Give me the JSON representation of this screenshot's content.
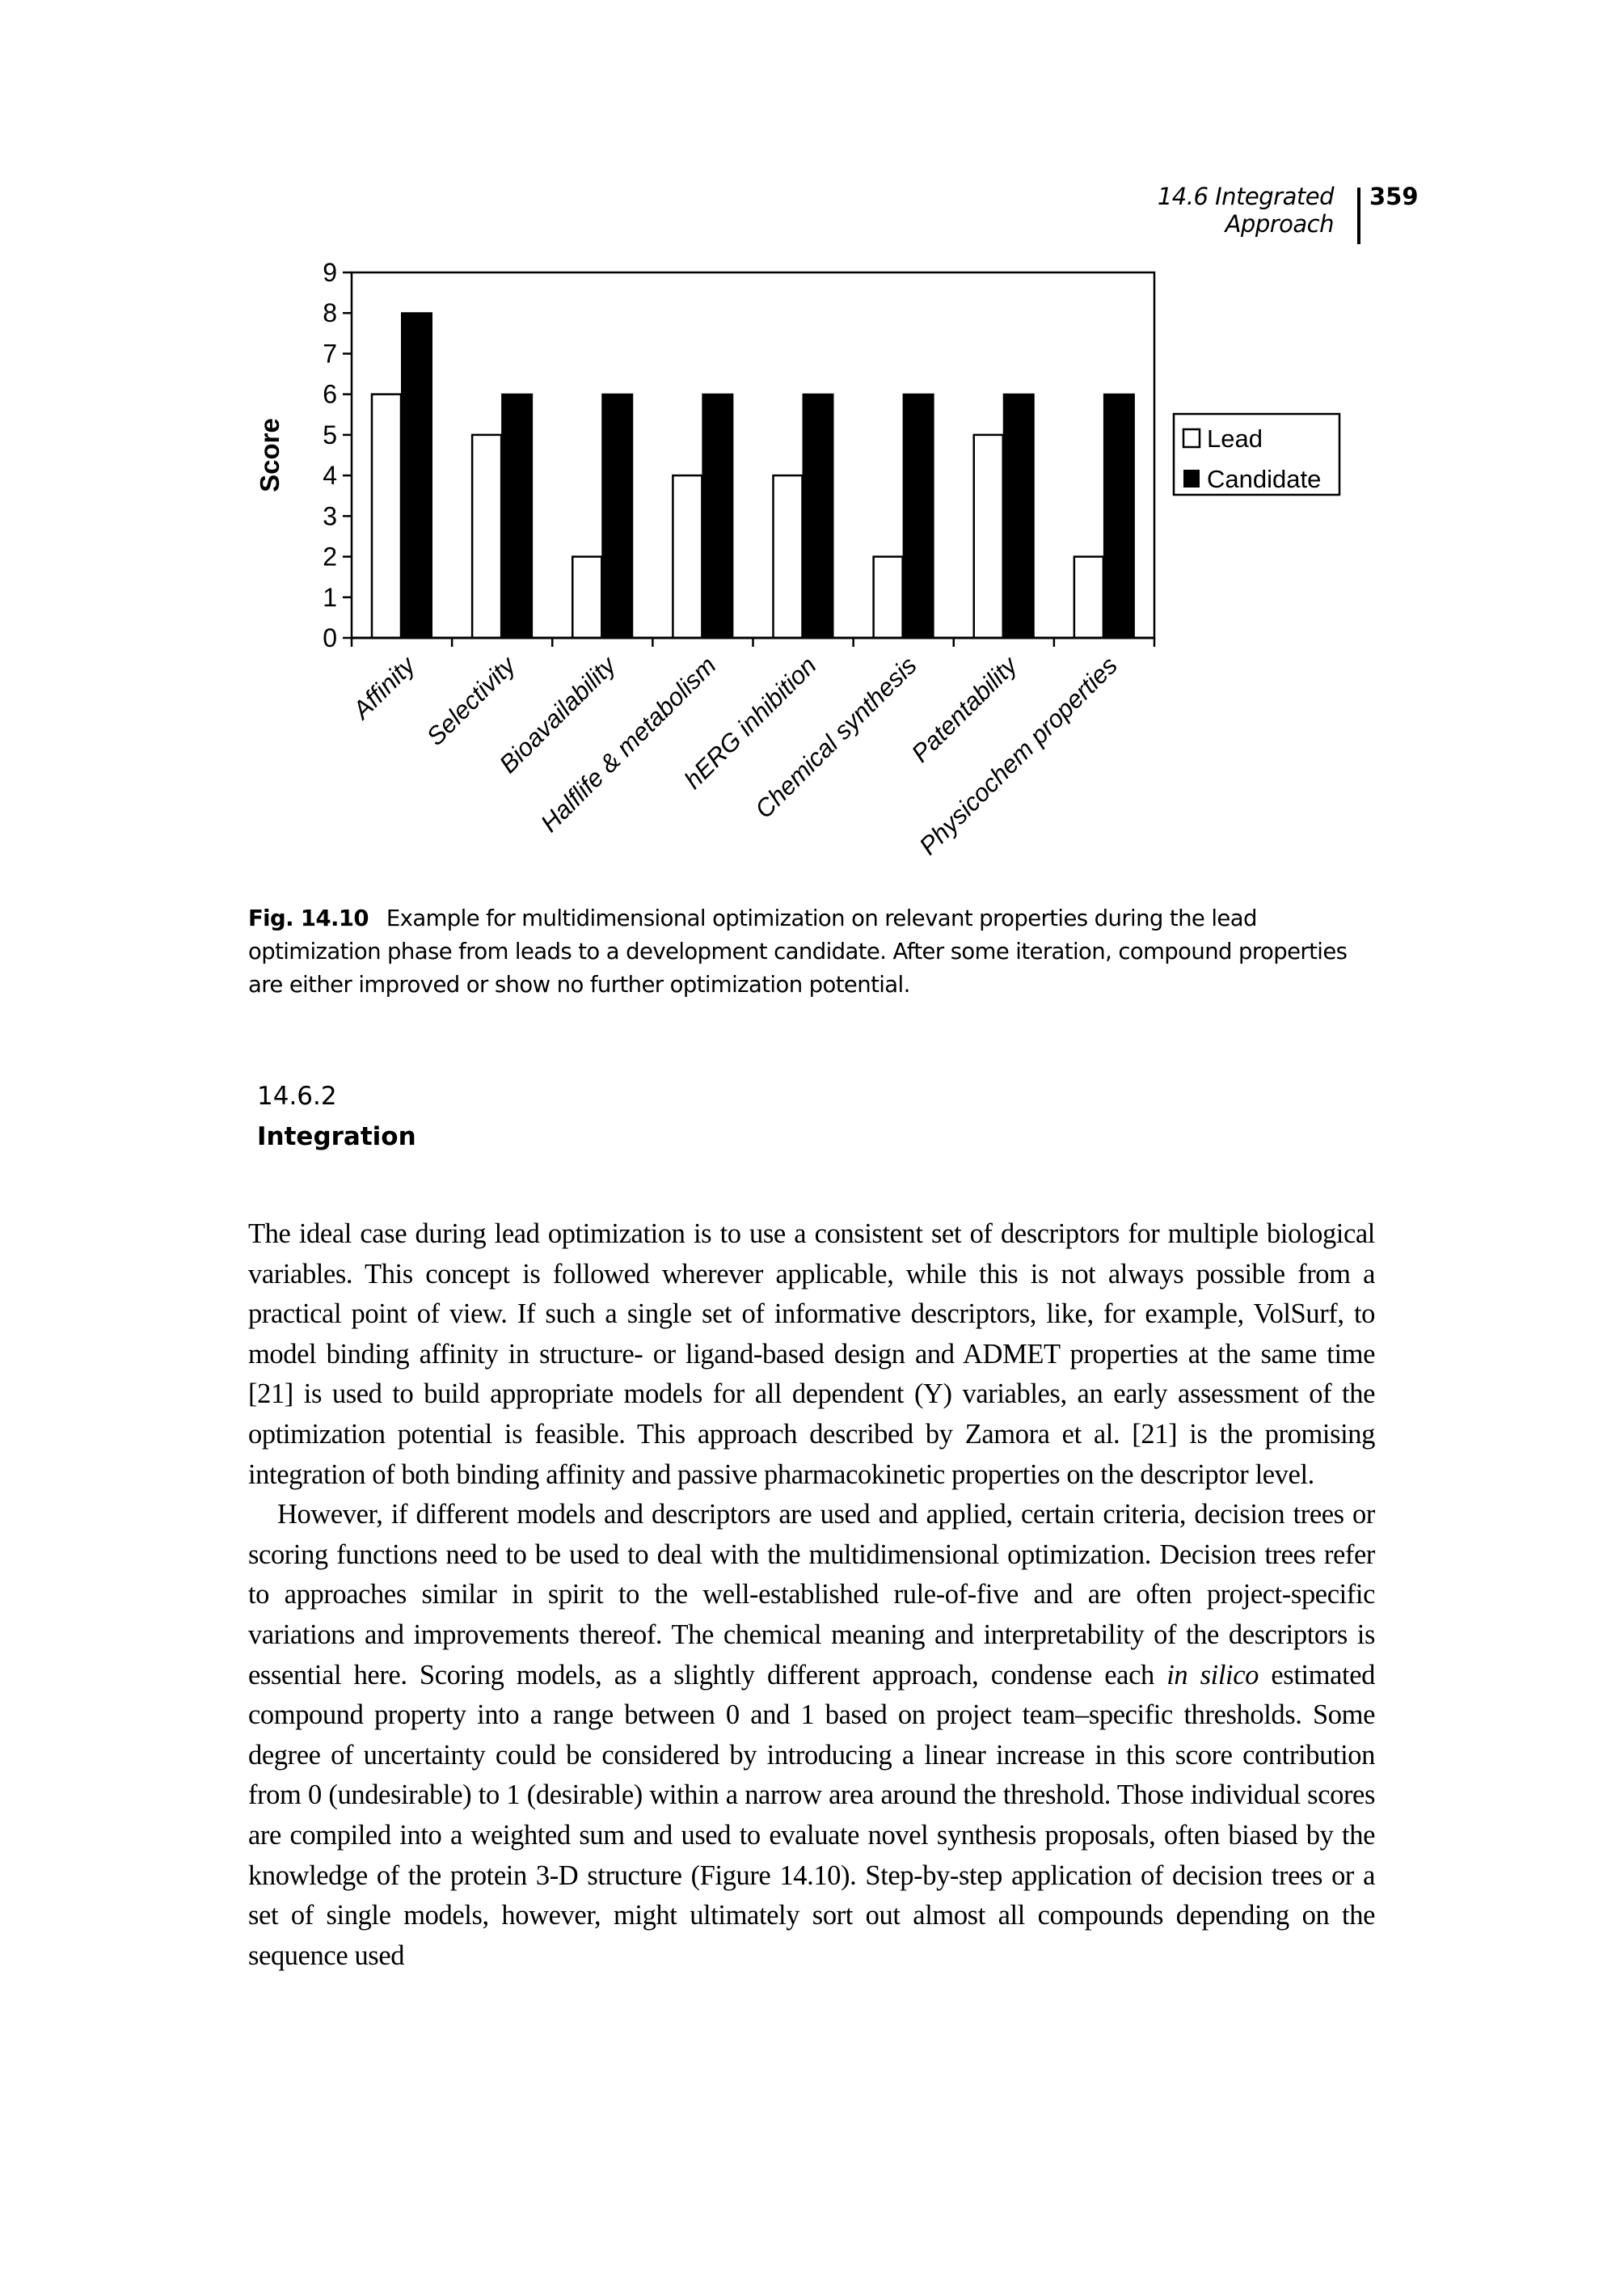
{
  "header": {
    "running_title": "14.6  Integrated Approach",
    "page_number": "359"
  },
  "chart_data": {
    "type": "bar",
    "title": "",
    "xlabel": "",
    "ylabel": "Score",
    "ylim": [
      0,
      9
    ],
    "yticks": [
      0,
      1,
      2,
      3,
      4,
      5,
      6,
      7,
      8,
      9
    ],
    "grid": false,
    "legend_position": "right",
    "categories": [
      "Affinity",
      "Selectivity",
      "Bioavailability",
      "Halflife & metabolism",
      "hERG inhibition",
      "Chemical synthesis",
      "Patentability",
      "Physicochem properties"
    ],
    "series": [
      {
        "name": "Lead",
        "fill": "#ffffff",
        "values": [
          6,
          5,
          2,
          4,
          4,
          2,
          5,
          2
        ]
      },
      {
        "name": "Candidate",
        "fill": "#000000",
        "values": [
          8,
          6,
          6,
          6,
          6,
          6,
          6,
          6
        ]
      }
    ]
  },
  "caption": {
    "label": "Fig. 14.10",
    "text": "Example for multidimensional optimization on relevant properties during the lead optimization phase from leads to a development candidate. After some iteration, compound properties are either improved or show no further optimization potential."
  },
  "section": {
    "number": "14.6.2",
    "title": "Integration"
  },
  "body": {
    "paragraphs": [
      "The ideal case during lead optimization is to use a consistent set of descriptors for multiple biological variables. This concept is followed wherever applicable, while this is not always possible from a practical point of view. If such a single set of informative descriptors, like, for example, VolSurf, to model binding affinity in structure- or ligand-based design and ADMET properties at the same time [21] is used to build appropriate models for all dependent (Y) variables, an early assessment of the optimization potential is feasible. This approach described by Zamora et al. [21] is the promising integration of both binding affinity and passive pharmacokinetic properties on the descriptor level.",
      {
        "before_italic": "However, if different models and descriptors are used and applied, certain criteria, decision trees or scoring functions need to be used to deal with the multidimensional optimization. Decision trees refer to approaches similar in spirit to the well-established rule-of-five and are often project-specific variations and improvements thereof. The chemical meaning and interpretability of the descriptors is essential here. Scoring models, as a slightly different approach, condense each ",
        "italic": "in silico",
        "after_italic": " estimated compound property into a range between 0 and 1 based on project team–specific thresholds. Some degree of uncertainty could be considered by introducing a linear increase in this score contribution from 0 (undesirable) to 1 (desirable) within a narrow area around the threshold. Those individual scores are compiled into a weighted sum and used to evaluate novel synthesis proposals, often biased by the knowledge of the protein 3-D structure (Figure 14.10). Step-by-step application of decision trees or a set of single models, however, might ultimately sort out almost all compounds depending on the sequence used"
      }
    ]
  }
}
